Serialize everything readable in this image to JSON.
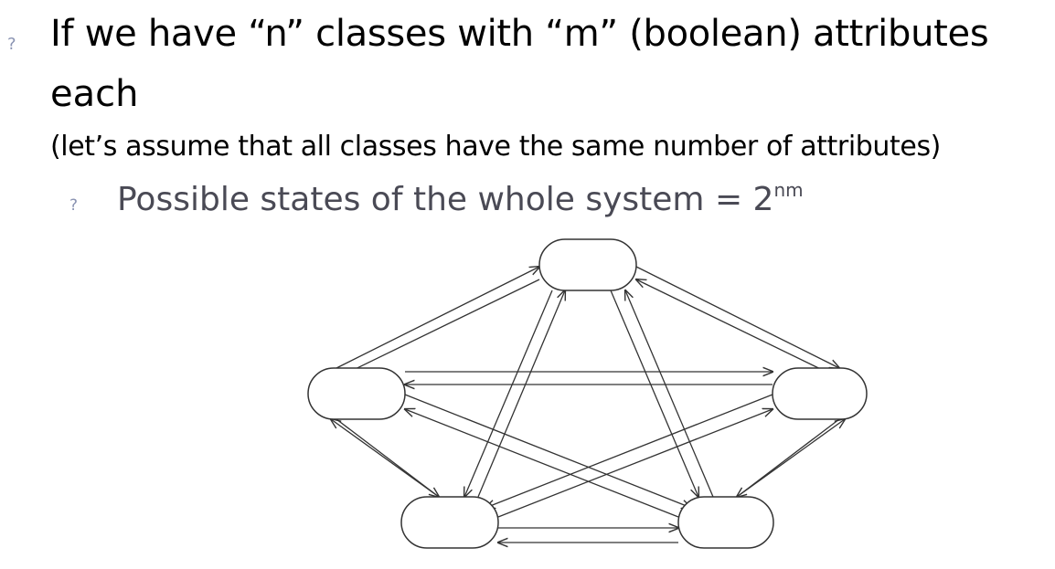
{
  "slide": {
    "bullet_glyph": "?",
    "point1": {
      "line1": "If we have “n” classes with “m” (boolean) attributes",
      "line2": "each",
      "note": "(let’s assume that all classes have the same number of attributes)"
    },
    "subpoint": {
      "text": "Possible states of the whole system = 2",
      "superscript": "nm"
    }
  },
  "diagram": {
    "description_nodes": [
      "top",
      "left",
      "right",
      "bottom-left",
      "bottom-right"
    ],
    "node_color": "#ffffff",
    "stroke_color": "#333333"
  }
}
